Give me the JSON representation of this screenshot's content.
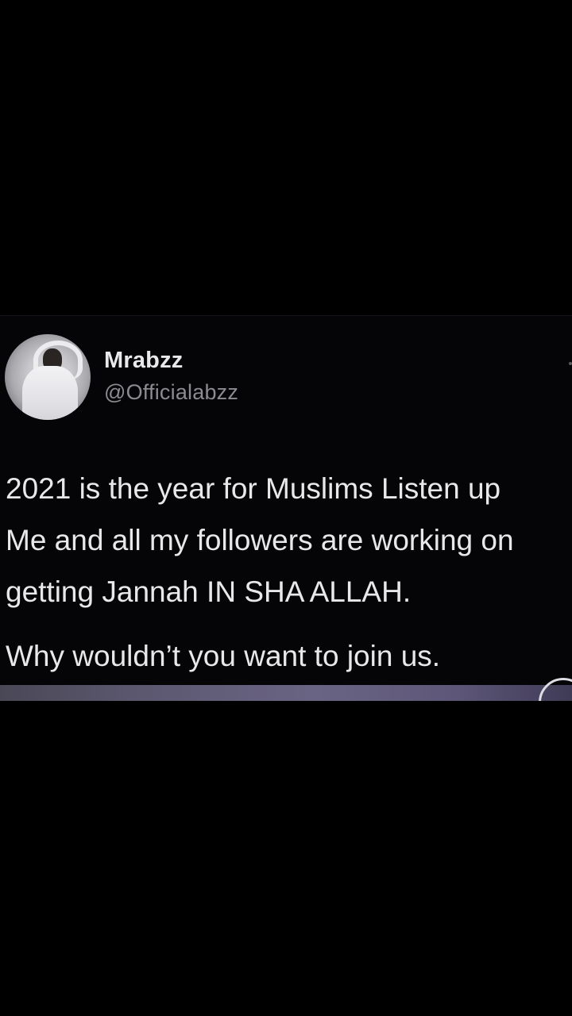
{
  "tweet": {
    "display_name": "Mrabzz",
    "handle": "@Officialabzz",
    "text_lines": [
      "2021 is the year for Muslims Listen up",
      "Me and all my followers are working on",
      "getting Jannah IN SHA ALLAH."
    ],
    "text_paragraph_2": "Why wouldn’t you want to join us."
  },
  "icons": {
    "avatar": "profile-photo",
    "more": "more-options-icon"
  },
  "colors": {
    "background": "#000000",
    "card": "#050507",
    "name": "#e9e9eb",
    "handle": "#8b8b90",
    "text": "#e8e8ea"
  }
}
